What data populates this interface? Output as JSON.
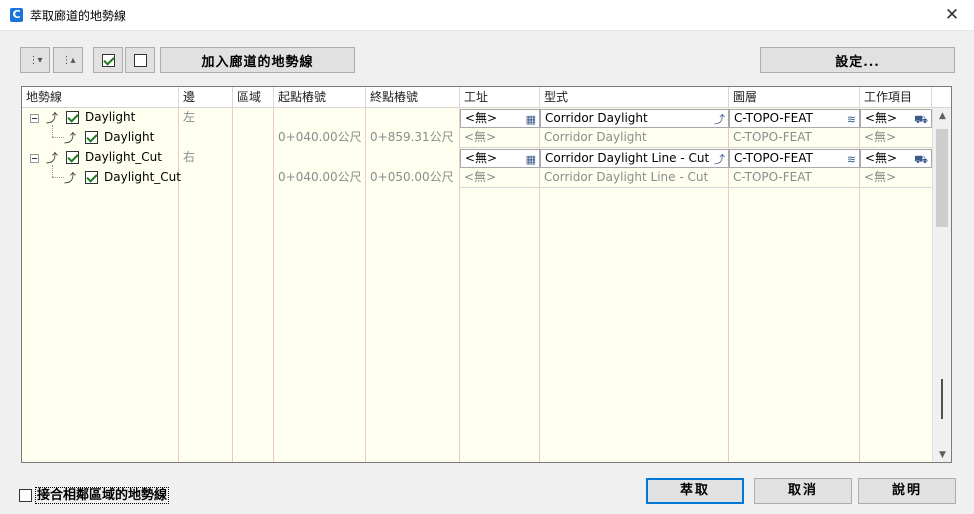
{
  "window": {
    "title": "萃取廊道的地勢線",
    "close_glyph": "✕",
    "app_icon_letter": "C"
  },
  "toolbar": {
    "expand_icon_glyph": "⋮▾",
    "collapse_icon_glyph": "⋮▴",
    "add_button_label": "加入廊道的地勢線",
    "settings_button_label": "設定..."
  },
  "grid": {
    "columns": [
      "地勢線",
      "邊",
      "區域",
      "起點樁號",
      "終點樁號",
      "工址",
      "型式",
      "圖層",
      "工作項目"
    ],
    "rows": [
      {
        "name": "Daylight",
        "checked": true,
        "level": 0,
        "side": "左",
        "region": "",
        "start": "",
        "end": "",
        "site": "<無>",
        "style": "Corridor Daylight",
        "layer": "C-TOPO-FEAT",
        "payitem": "<無>",
        "editable": true
      },
      {
        "name": "Daylight",
        "checked": true,
        "level": 1,
        "side": "",
        "region": "",
        "start": "0+040.00公尺",
        "end": "0+859.31公尺",
        "site": "<無>",
        "style": "Corridor Daylight",
        "layer": "C-TOPO-FEAT",
        "payitem": "<無>",
        "editable": false
      },
      {
        "name": "Daylight_Cut",
        "checked": true,
        "level": 0,
        "side": "右",
        "region": "",
        "start": "",
        "end": "",
        "site": "<無>",
        "style": "Corridor Daylight Line - Cut",
        "layer": "C-TOPO-FEAT",
        "payitem": "<無>",
        "editable": true
      },
      {
        "name": "Daylight_Cut",
        "checked": true,
        "level": 1,
        "side": "",
        "region": "",
        "start": "0+040.00公尺",
        "end": "0+050.00公尺",
        "site": "<無>",
        "style": "Corridor Daylight Line - Cut",
        "layer": "C-TOPO-FEAT",
        "payitem": "<無>",
        "editable": false
      }
    ]
  },
  "footer": {
    "join_checkbox_label": "接合相鄰區域的地勢線",
    "join_checked": false,
    "extract_button_label": "萃取",
    "cancel_button_label": "取消",
    "help_button_label": "說明"
  },
  "scrollbar": {
    "up_glyph": "▲",
    "down_glyph": "▼"
  },
  "colors": {
    "grid_background": "#fffff0",
    "column_divider": "#efc7c7",
    "checkbox_check": "#1d7a1d",
    "default_button_border": "#0078d7",
    "app_icon": "#1a73d9"
  }
}
